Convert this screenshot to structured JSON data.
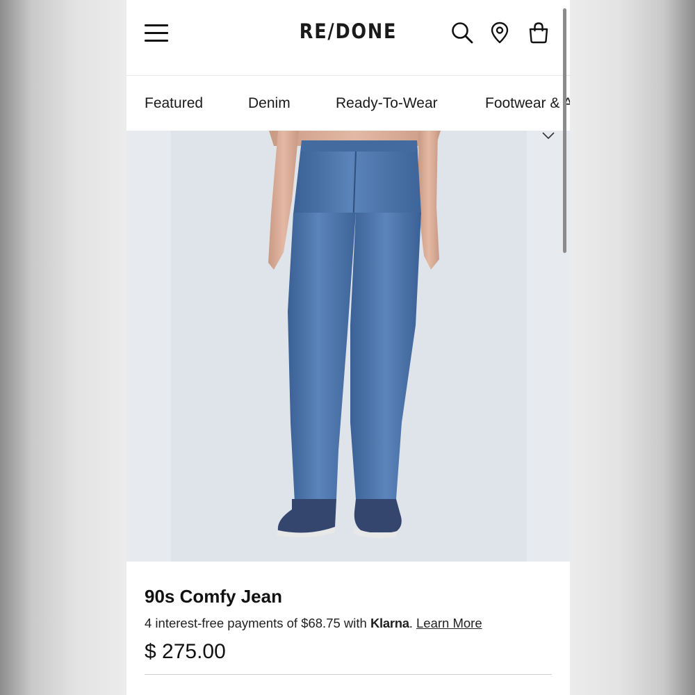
{
  "header": {
    "logo": "RE/DONE",
    "menu_icon": "hamburger-menu-icon",
    "search_icon": "search-icon",
    "location_icon": "location-pin-icon",
    "bag_icon": "shopping-bag-icon"
  },
  "nav": {
    "items": [
      {
        "label": "Featured"
      },
      {
        "label": "Denim"
      },
      {
        "label": "Ready-To-Wear"
      },
      {
        "label": "Footwear & A"
      }
    ]
  },
  "product": {
    "image_subject": "90s Comfy Jean",
    "wishlist_icon": "heart-icon",
    "title": "90s Comfy Jean",
    "installment_prefix": "4 interest-free payments of $68.75 with",
    "installment_brand": "Klarna",
    "installment_period": ".",
    "learn_more": "Learn More",
    "price": "$ 275.00"
  },
  "colors": {
    "denim_mid": "#4d76ad",
    "denim_dark": "#3a5f93",
    "text": "#111111",
    "background": "#ffffff"
  }
}
